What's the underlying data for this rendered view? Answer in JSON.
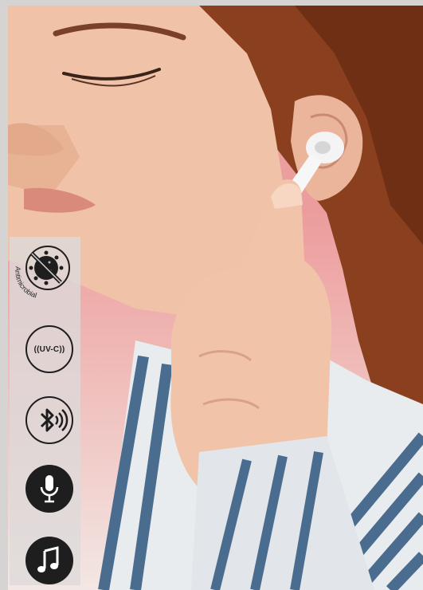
{
  "features": [
    {
      "icon": "antimicrobial-icon",
      "label": "Antimicrobial"
    },
    {
      "icon": "uv-c-icon",
      "text": "((UV-C))"
    },
    {
      "icon": "bluetooth-icon"
    },
    {
      "icon": "microphone-icon"
    },
    {
      "icon": "music-note-icon"
    }
  ]
}
